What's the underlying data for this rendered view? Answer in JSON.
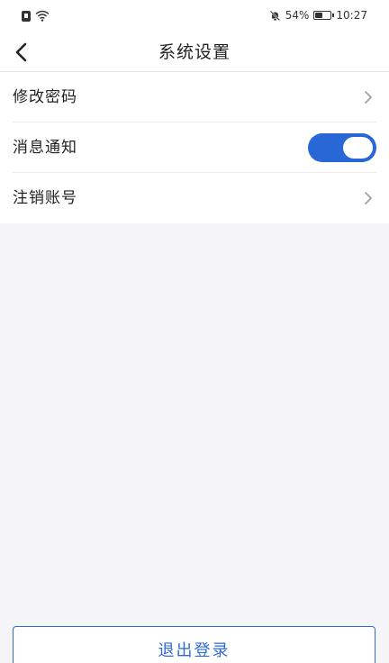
{
  "status_bar": {
    "battery_percent_text": "54%",
    "battery_level": 0.54,
    "time": "10:27",
    "icons": [
      "sim-icon",
      "wifi-icon",
      "mute-bell-icon",
      "battery-icon"
    ]
  },
  "nav": {
    "title": "系统设置",
    "back_icon": "chevron-left-icon"
  },
  "settings": {
    "items": [
      {
        "label": "修改密码",
        "control": "chevron-right-icon"
      },
      {
        "label": "消息通知",
        "control": "toggle",
        "toggle_on": true
      },
      {
        "label": "注销账号",
        "control": "chevron-right-icon"
      }
    ]
  },
  "logout": {
    "label": "退出登录"
  },
  "colors": {
    "accent": "#2867d6",
    "background": "#f5f5f7",
    "surface": "#ffffff"
  }
}
